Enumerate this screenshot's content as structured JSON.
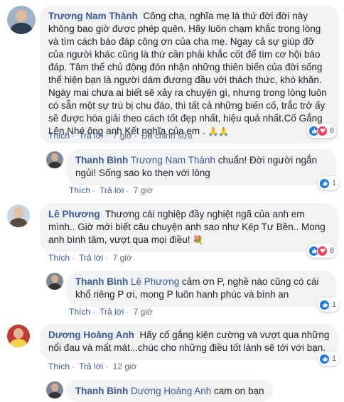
{
  "actions": {
    "like": "Thích",
    "reply": "Trả lời",
    "edited": "Đã chỉnh sửa",
    "sep": "·"
  },
  "comments": [
    {
      "author": "Trương Nam Thành",
      "text": "Công cha, nghĩa mẹ là thứ đời đời này không bao giờ được phép quên. Hãy luôn chạm khắc trong lòng và tìm cách báo đáp công ơn của cha mẹ. Ngay cả sự giúp đỡ của người khác cũng là thứ cần phải khắc cốt để tìm cơ hội báo đáp. Tâm thế chủ động đón nhận những thiên biến của đời sống thể hiện bạn là người dám đương đầu với thách thức, khó khăn. Ngày mai chưa ai biết sẽ xảy ra chuyện gì, nhưng trong lòng luôn có sẵn một sự trù bị chu đáo, thì tất cả những biến cố, trắc trở ấy sẽ được hóa giải theo cách tốt đẹp nhất, hiệu quả nhất.Cố Gắng Lên Nhé ông anh Kết nghĩa của em .",
      "emoji": "🙏🙏",
      "time": "7 giờ",
      "reaction_count": "6"
    },
    {
      "author": "Thanh Bình",
      "tag": "Trương Nam Thành",
      "text": "chuẩn! Đời người ngắn ngủi! Sống sao ko thẹn với lòng",
      "time": "7 giờ",
      "reaction_count": "1"
    },
    {
      "author": "Lê Phương",
      "text": "Thương cái nghiệp đầy nghiệt ngã của anh em mình.. Giờ mới biết câu chuyện anh sao như Kép Tư Bền.. Mong anh bình tâm, vượt qua mọi điều!",
      "emoji": "💐",
      "time": "7 giờ",
      "reaction_count": "6"
    },
    {
      "author": "Thanh Bình",
      "tag": "Lê Phương",
      "text": "cảm ơn P, nghề nào cũng có cái khổ riêng P ơi, mong P luôn hanh phúc và bình an",
      "time": "7 giờ",
      "reaction_count": "1"
    },
    {
      "author": "Dương Hoàng Anh",
      "text": "Hãy cố gắng kiện cường và vượt qua những nổi đau và mất mát...chúc cho những điều tốt lành sẽ tới với bạn.",
      "time": "12 giờ",
      "reaction_count": "1"
    },
    {
      "author": "Thanh Bình",
      "tag": "Dương Hoàng Anh",
      "text": "cam on bạn"
    }
  ]
}
